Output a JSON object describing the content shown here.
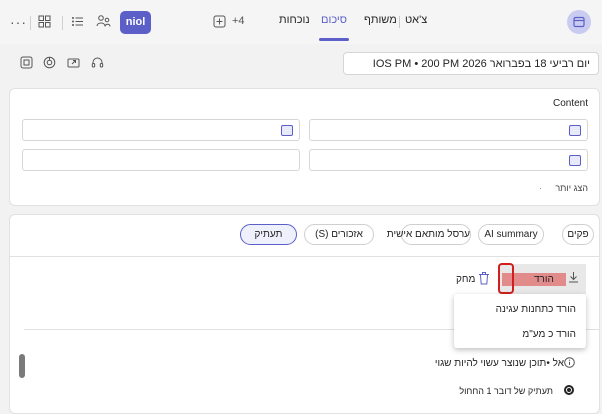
{
  "header": {
    "title": "צ'אט",
    "tabs": [
      {
        "label": "משותף",
        "active": false
      },
      {
        "label": "סיכום",
        "active": true
      },
      {
        "label": "נוכחות",
        "active": false
      }
    ],
    "add_tab_label": "+4",
    "app_badge_label": "niol",
    "more_label": "···",
    "accent_color": "#5b5fc7"
  },
  "meeting": {
    "date_text": "יום רביעי  18 בפברואר 2026  IOS PM • 200 PM",
    "toolbar_icons": [
      "headset-icon",
      "share-screen-icon",
      "loop-icon",
      "expand-icon"
    ]
  },
  "content_card": {
    "heading": "Content",
    "show_more_label": "הצג יותר"
  },
  "filter_chips": [
    {
      "label": "פקים",
      "selected": false
    },
    {
      "label": "AI summary",
      "selected": false
    },
    {
      "label": "ערסל מותאם אישית",
      "selected": false
    },
    {
      "label": "אזכורים (S)",
      "selected": false
    },
    {
      "label": "תעתיק",
      "selected": true
    }
  ],
  "transcript_toolbar": {
    "download_label": "הורד",
    "delete_label": "מחק",
    "download_menu": [
      "הורד כתחנות עגינה",
      "הורד כ מע\"מ"
    ]
  },
  "notice": {
    "text": "אל •תוכן שנוצר עשוי להיות שגוי",
    "radio_label": "תעתיק של דובר 1 החחול"
  }
}
